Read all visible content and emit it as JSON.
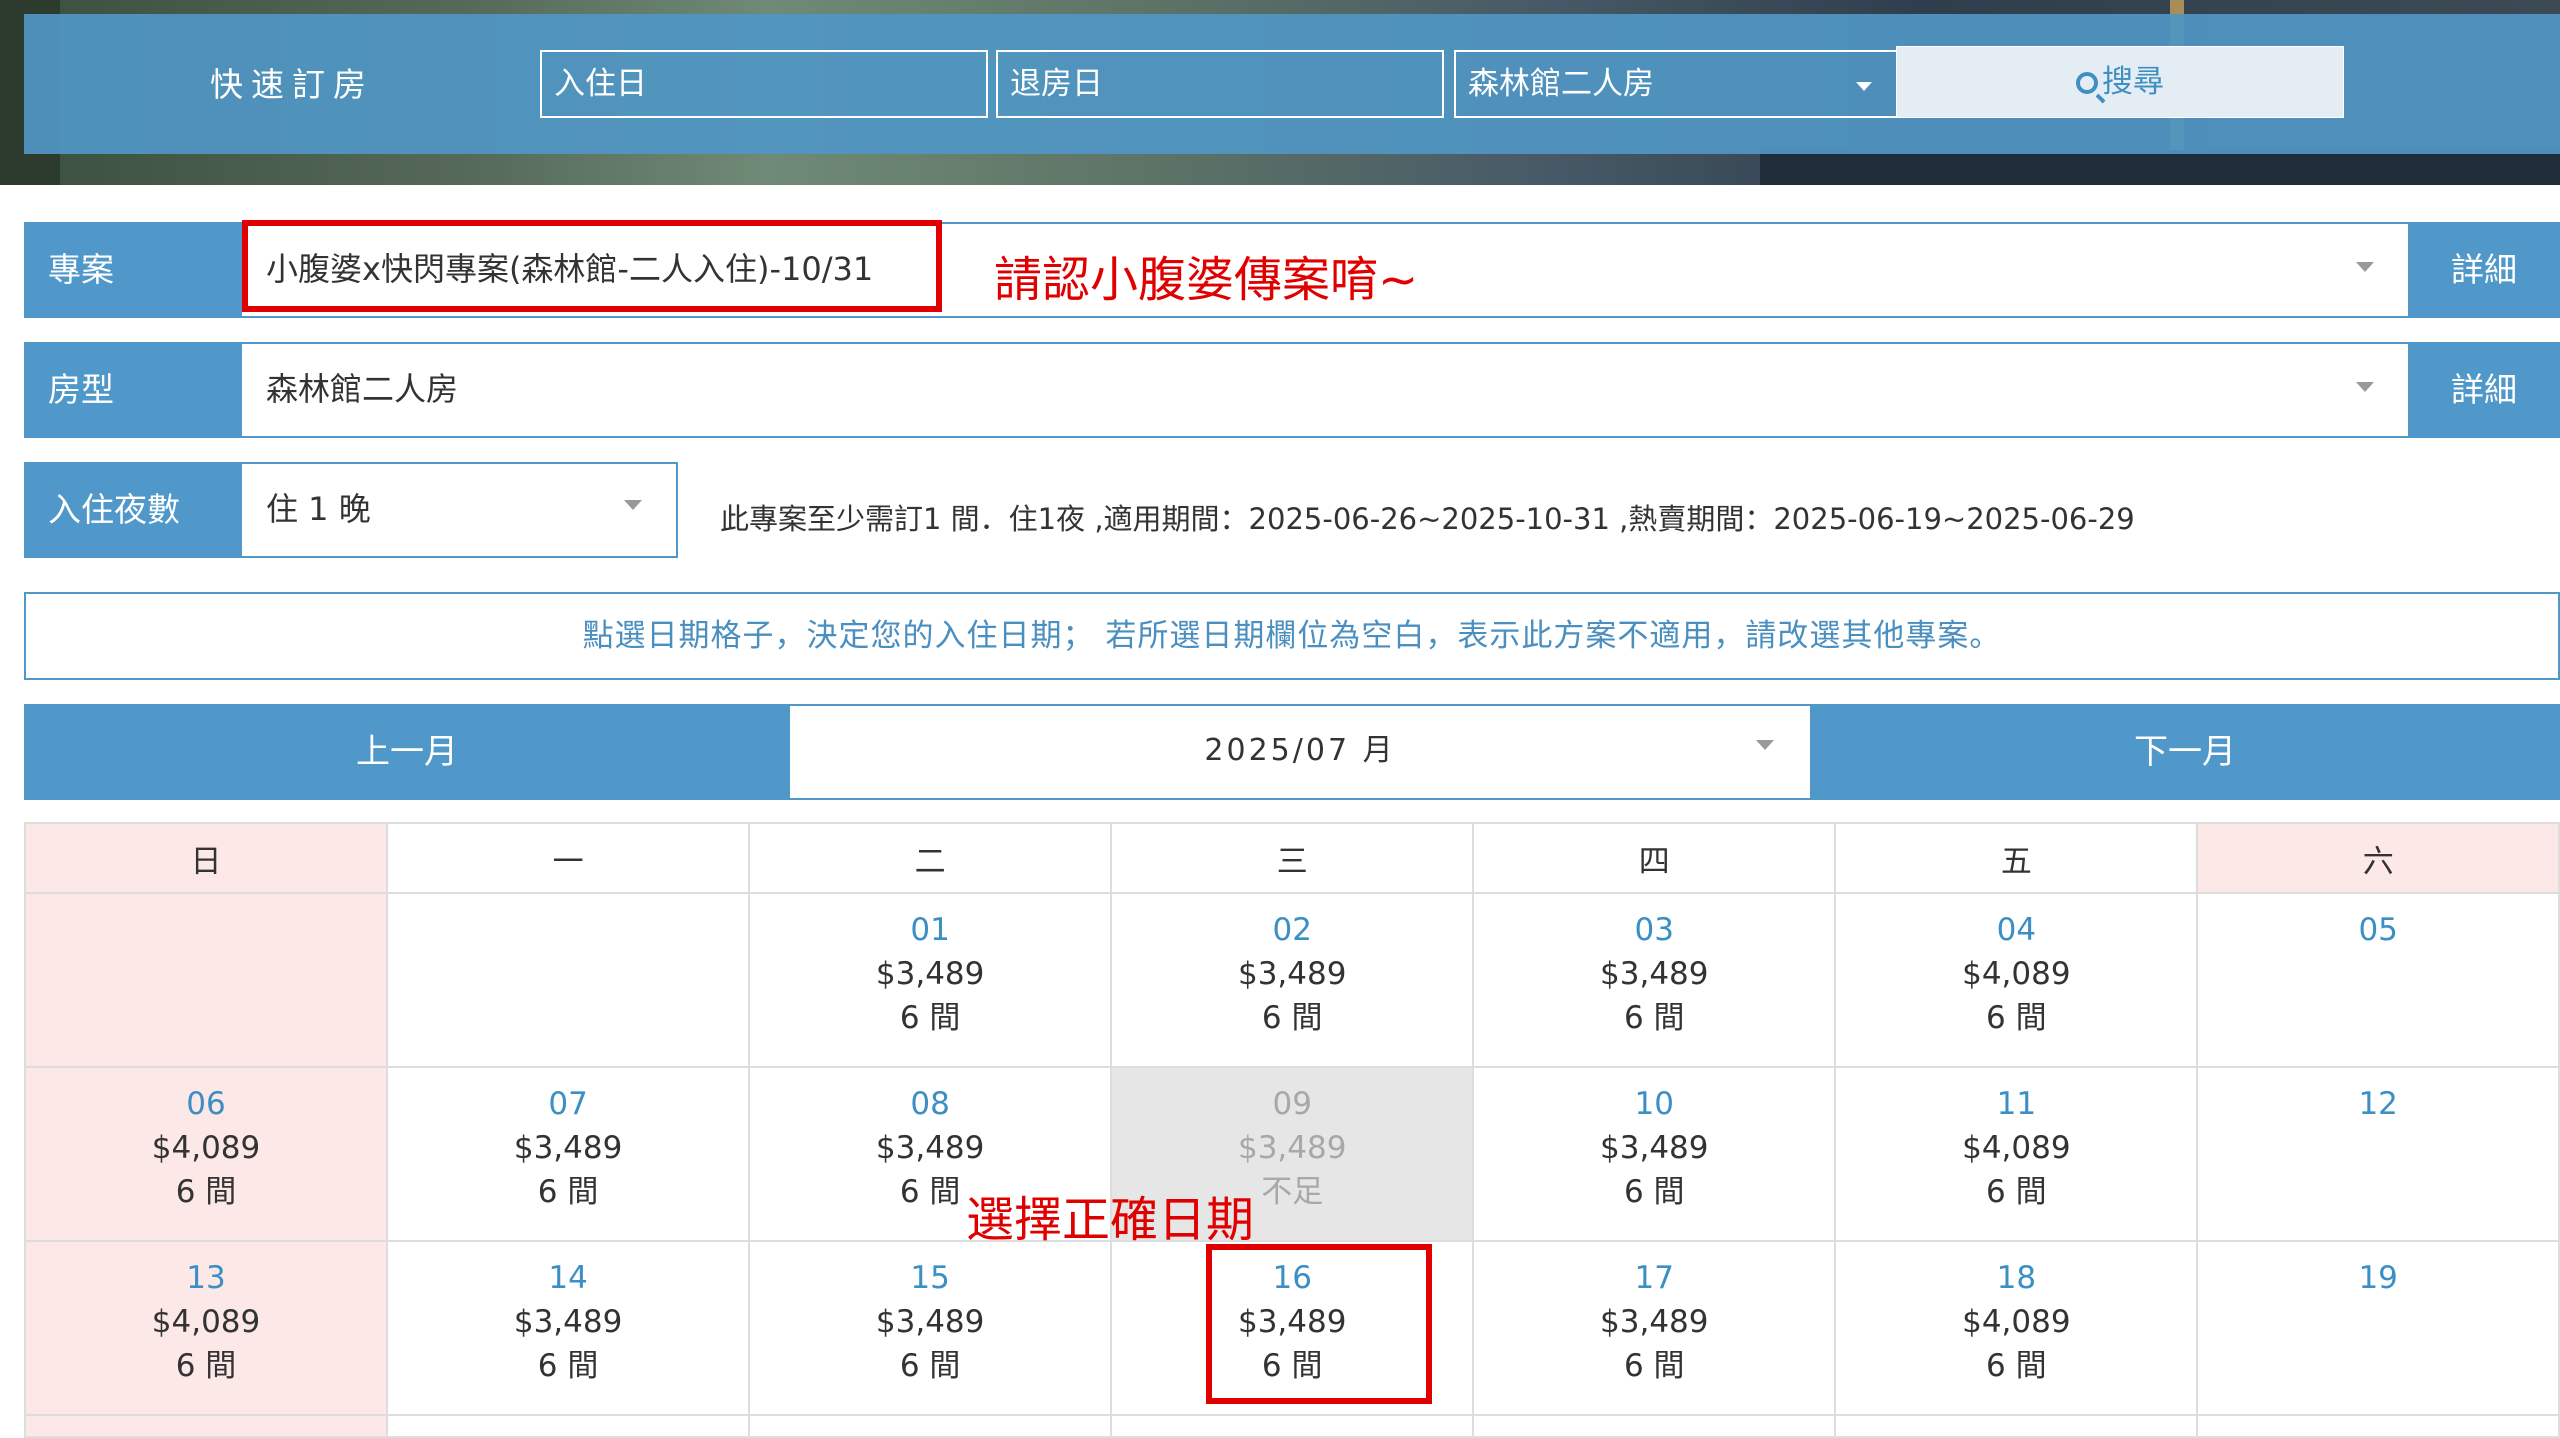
{
  "quick_booking": {
    "title": "快速訂房",
    "checkin_placeholder": "入住日",
    "checkout_placeholder": "退房日",
    "room_select": "森林館二人房",
    "search_label": "搜尋"
  },
  "plan": {
    "label": "專案",
    "value": "小腹婆x快閃專案(森林館-二人入住)-10/31",
    "detail": "詳細",
    "annotation": "請認小腹婆傳案唷~"
  },
  "room": {
    "label": "房型",
    "value": "森林館二人房",
    "detail": "詳細"
  },
  "nights": {
    "label": "入住夜數",
    "value": "住 1 晚",
    "info": "此專案至少需訂1 間．住1夜 ,適用期間：2025-06-26~2025-10-31 ,熱賣期間：2025-06-19~2025-06-29"
  },
  "hint": "點選日期格子，決定您的入住日期； 若所選日期欄位為空白，表示此方案不適用，請改選其他專案。",
  "calendar": {
    "prev": "上一月",
    "next": "下一月",
    "month": "2025/07 月",
    "weekdays": [
      "日",
      "一",
      "二",
      "三",
      "四",
      "五",
      "六"
    ],
    "annotation": "選擇正確日期",
    "weeks": [
      [
        null,
        null,
        {
          "day": "01",
          "price": "$3,489",
          "rooms": "6 間"
        },
        {
          "day": "02",
          "price": "$3,489",
          "rooms": "6 間"
        },
        {
          "day": "03",
          "price": "$3,489",
          "rooms": "6 間"
        },
        {
          "day": "04",
          "price": "$4,089",
          "rooms": "6 間"
        },
        {
          "day": "05",
          "price": "",
          "rooms": ""
        }
      ],
      [
        {
          "day": "06",
          "price": "$4,089",
          "rooms": "6 間"
        },
        {
          "day": "07",
          "price": "$3,489",
          "rooms": "6 間"
        },
        {
          "day": "08",
          "price": "$3,489",
          "rooms": "6 間"
        },
        {
          "day": "09",
          "price": "$3,489",
          "rooms": "不足"
        },
        {
          "day": "10",
          "price": "$3,489",
          "rooms": "6 間"
        },
        {
          "day": "11",
          "price": "$4,089",
          "rooms": "6 間"
        },
        {
          "day": "12",
          "price": "",
          "rooms": ""
        }
      ],
      [
        {
          "day": "13",
          "price": "$4,089",
          "rooms": "6 間"
        },
        {
          "day": "14",
          "price": "$3,489",
          "rooms": "6 間"
        },
        {
          "day": "15",
          "price": "$3,489",
          "rooms": "6 間"
        },
        {
          "day": "16",
          "price": "$3,489",
          "rooms": "6 間"
        },
        {
          "day": "17",
          "price": "$3,489",
          "rooms": "6 間"
        },
        {
          "day": "18",
          "price": "$4,089",
          "rooms": "6 間"
        },
        {
          "day": "19",
          "price": "",
          "rooms": ""
        }
      ]
    ]
  },
  "colors": {
    "primary": "#5098c9",
    "weekend": "#fce8e6",
    "annotation": "#e00000",
    "disabled": "#e6e6e6"
  }
}
